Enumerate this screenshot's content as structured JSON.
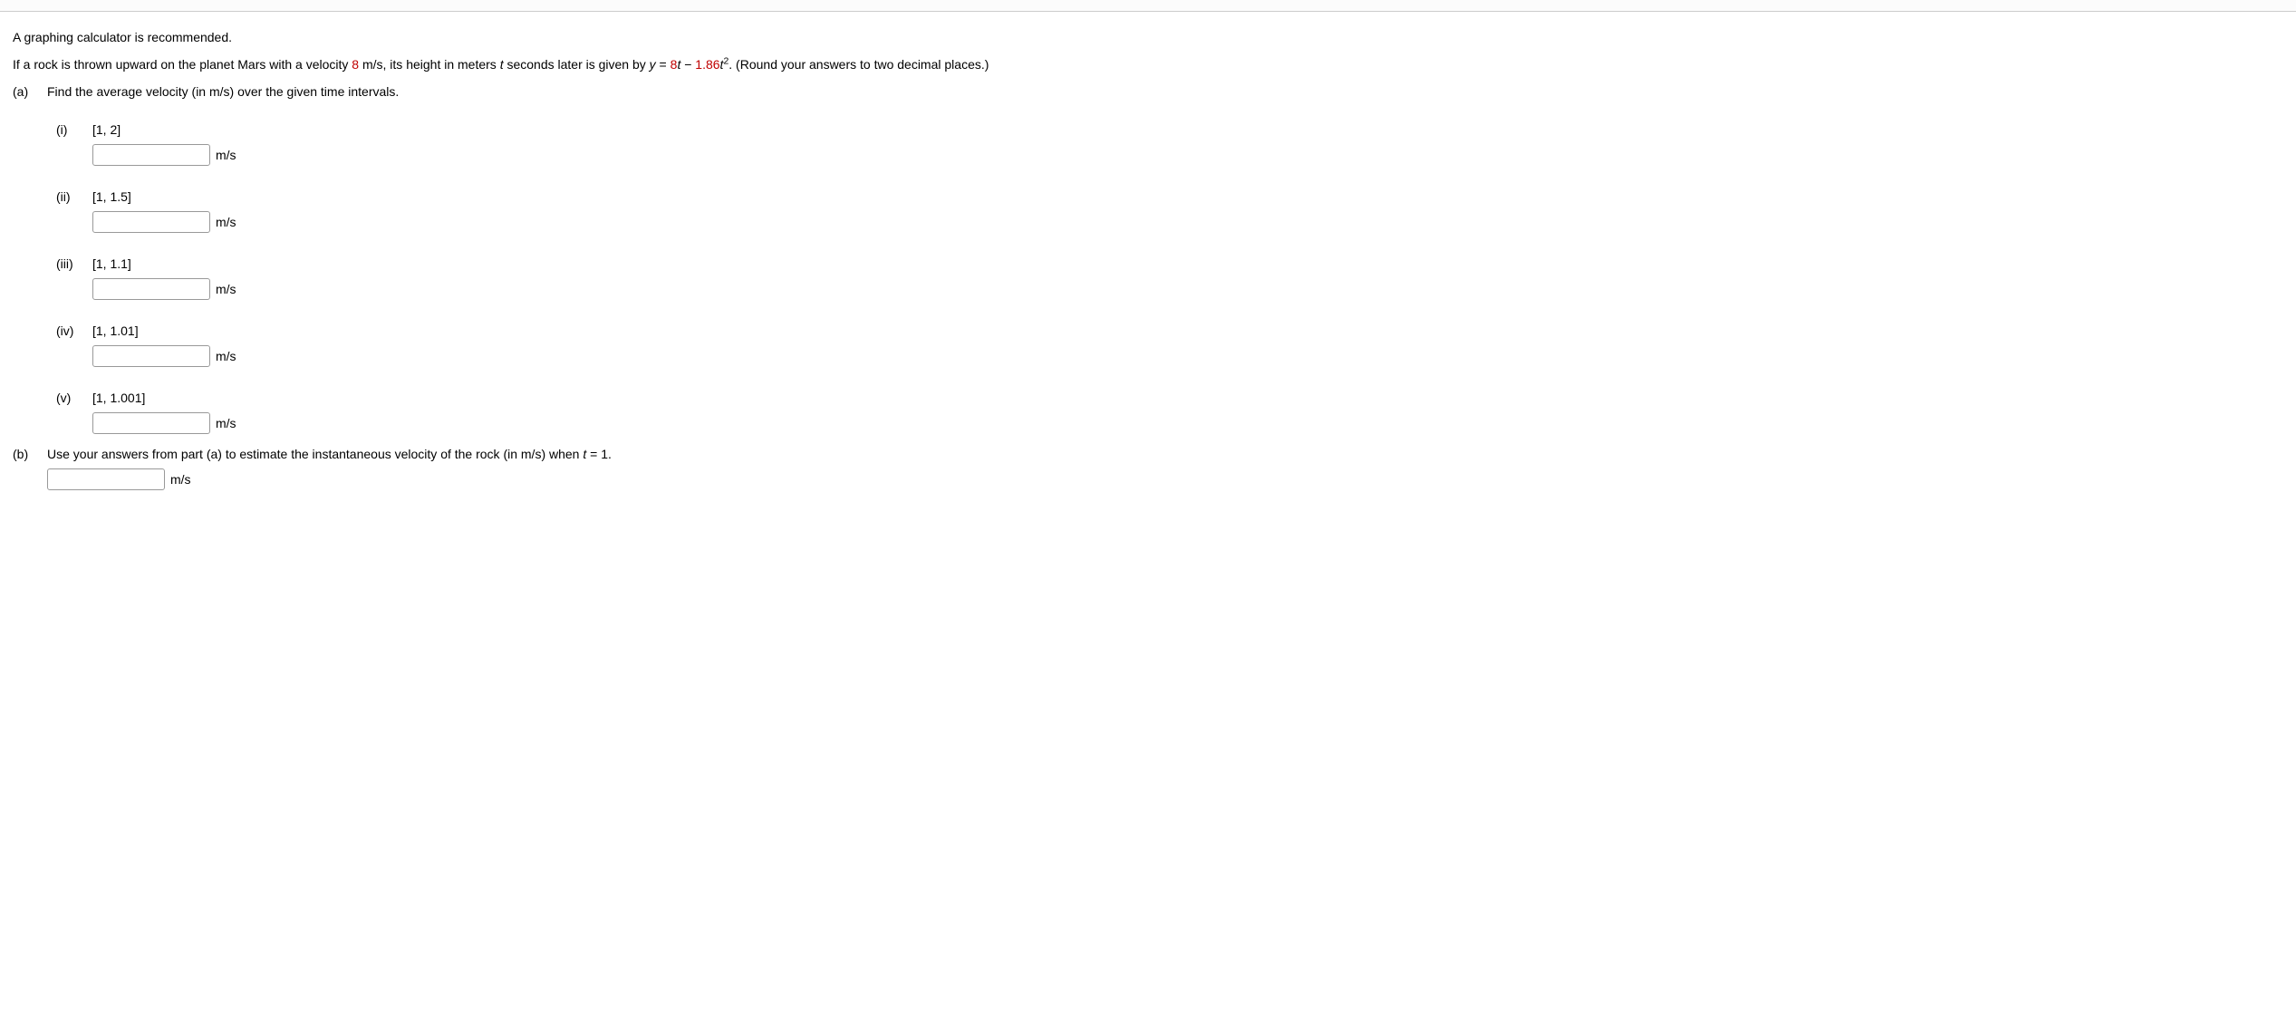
{
  "intro": "A graphing calculator is recommended.",
  "problem": {
    "prefix": "If a rock is thrown upward on the planet Mars with a velocity ",
    "velocity_value": "8",
    "mid1": " m/s, its height in meters ",
    "t_var": "t",
    "mid2": " seconds later is given by ",
    "y_var": "y",
    "eq_spacer": " = ",
    "term1_coef": "8",
    "term1_var": "t",
    "minus": " − ",
    "term2_coef": "1.86",
    "term2_var": "t",
    "term2_exp": "2",
    "suffix": ". (Round your answers to two decimal places.)"
  },
  "part_a": {
    "label": "(a)",
    "text": "Find the average velocity (in m/s) over the given time intervals.",
    "items": [
      {
        "label": "(i)",
        "interval": "[1, 2]",
        "unit": "m/s"
      },
      {
        "label": "(ii)",
        "interval": "[1, 1.5]",
        "unit": "m/s"
      },
      {
        "label": "(iii)",
        "interval": "[1, 1.1]",
        "unit": "m/s"
      },
      {
        "label": "(iv)",
        "interval": "[1, 1.01]",
        "unit": "m/s"
      },
      {
        "label": "(v)",
        "interval": "[1, 1.001]",
        "unit": "m/s"
      }
    ]
  },
  "part_b": {
    "label": "(b)",
    "prefix": "Use your answers from part (a) to estimate the instantaneous velocity of the rock (in m/s) when ",
    "t_var": "t",
    "eq": " = 1.",
    "unit": "m/s"
  }
}
